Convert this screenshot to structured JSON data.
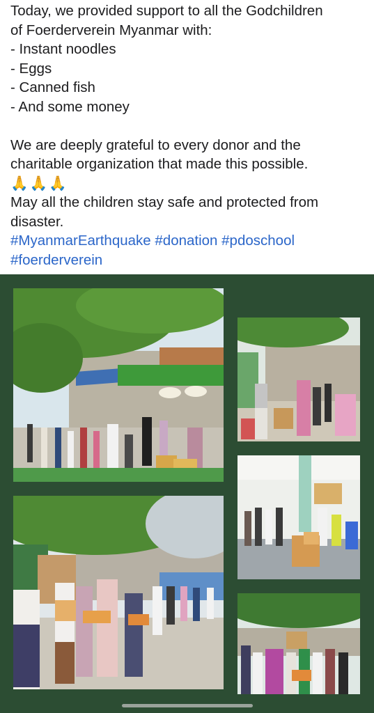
{
  "post": {
    "lines": [
      "Today, we provided support to all the Godchildren",
      "of Foerderverein Myanmar with:",
      "- Instant noodles",
      "- Eggs",
      "- Canned fish",
      "- And some money"
    ],
    "gratitude_lines": [
      "We are deeply grateful to every donor and the",
      "charitable organization that made this possible."
    ],
    "emoji": [
      "🙏",
      "🙏",
      "🙏"
    ],
    "blessing_lines": [
      "May all the children stay safe and protected from",
      "disaster."
    ],
    "hashtags": [
      "#MyanmarEarthquake",
      "#donation",
      "#pdoschool",
      "#foerderverein"
    ]
  },
  "colors": {
    "collage_background": "#2c4d33",
    "hashtag_link": "#2b66c9",
    "text": "#1c1c1e"
  },
  "photos": [
    {
      "description_name": "photo-street-distribution-line"
    },
    {
      "description_name": "photo-girls-carrying-boxes"
    },
    {
      "description_name": "photo-hall-boxes-queue"
    },
    {
      "description_name": "photo-women-receiving-boxes"
    },
    {
      "description_name": "photo-crowd-under-trees"
    }
  ]
}
